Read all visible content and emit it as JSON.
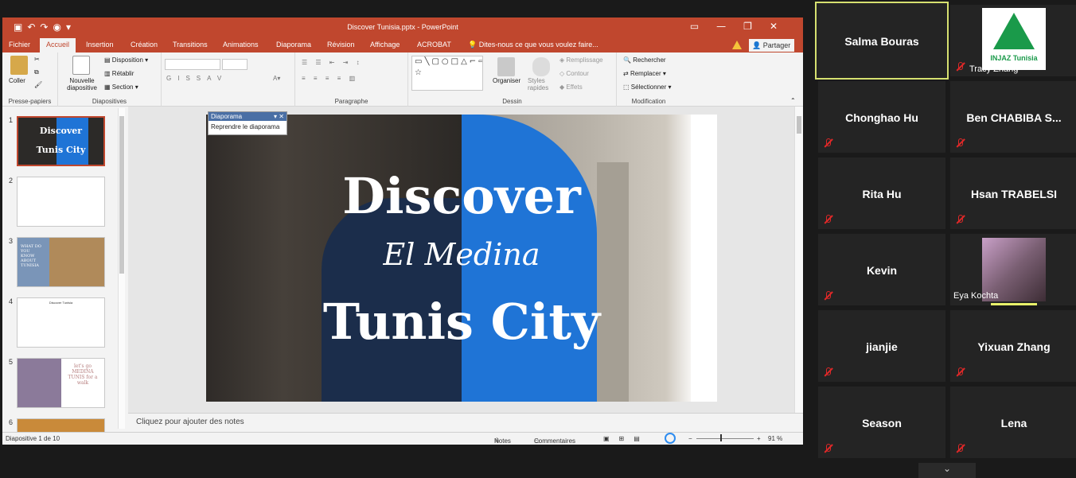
{
  "window": {
    "title": "Discover Tunisia.pptx - PowerPoint",
    "qat_icons": [
      "save-icon",
      "undo-icon",
      "redo-icon",
      "slideshow-icon",
      "customize-icon"
    ]
  },
  "tabs": [
    "Fichier",
    "Accueil",
    "Insertion",
    "Création",
    "Transitions",
    "Animations",
    "Diaporama",
    "Révision",
    "Affichage",
    "ACROBAT"
  ],
  "tell_me": "Dites-nous ce que vous voulez faire...",
  "share_label": "Partager",
  "ribbon": {
    "paste": "Coller",
    "clipboard_label": "Presse-papiers",
    "new_slide": "Nouvelle diapositive",
    "layout": "Disposition",
    "reset": "Rétablir",
    "section": "Section",
    "slides_label": "Diapositives",
    "paragraph_label": "Paragraphe",
    "arrange": "Organiser",
    "quick_styles": "Styles rapides",
    "fill": "Remplissage",
    "outline": "Contour",
    "effects": "Effets",
    "drawing_label": "Dessin",
    "find": "Rechercher",
    "replace": "Remplacer",
    "select": "Sélectionner",
    "editing_label": "Modification"
  },
  "popup": {
    "title": "Diaporama",
    "action": "Reprendre le diaporama"
  },
  "thumbnails": [
    {
      "num": "1",
      "line1": "Discover",
      "line2": "Tunis City"
    },
    {
      "num": "2"
    },
    {
      "num": "3",
      "text": "WHAT DO YOU KNOW ABOUT TUNISIA"
    },
    {
      "num": "4",
      "text": "Discover Tunisia"
    },
    {
      "num": "5",
      "text": "let's go MEDINA TUNIS for a walk"
    },
    {
      "num": "6"
    }
  ],
  "slide": {
    "title_line1": "Discover",
    "script_line": "El Medina",
    "title_line2": "Tunis City"
  },
  "notes_placeholder": "Cliquez pour ajouter des notes",
  "status": {
    "slide_counter": "Diapositive 1 de 10",
    "notes": "Notes",
    "comments": "Commentaires",
    "zoom": "91 %"
  },
  "participants": [
    {
      "name": "Salma Bouras",
      "active": true
    },
    {
      "name": "Tracy Zhang",
      "has_logo": true,
      "logo_text": "INJAZ Tunisia"
    },
    {
      "name": "Chonghao Hu"
    },
    {
      "name": "Ben CHABIBA S..."
    },
    {
      "name": "Rita Hu"
    },
    {
      "name": "Hsan TRABELSI"
    },
    {
      "name": "Kevin"
    },
    {
      "name": "Eya Kochta",
      "has_photo": true
    },
    {
      "name": "jianjie"
    },
    {
      "name": "Yixuan Zhang"
    },
    {
      "name": "Season"
    },
    {
      "name": "Lena"
    }
  ],
  "colors": {
    "ppt_accent": "#c0472e",
    "active_speaker": "#d6e070",
    "muted": "#e02828"
  }
}
